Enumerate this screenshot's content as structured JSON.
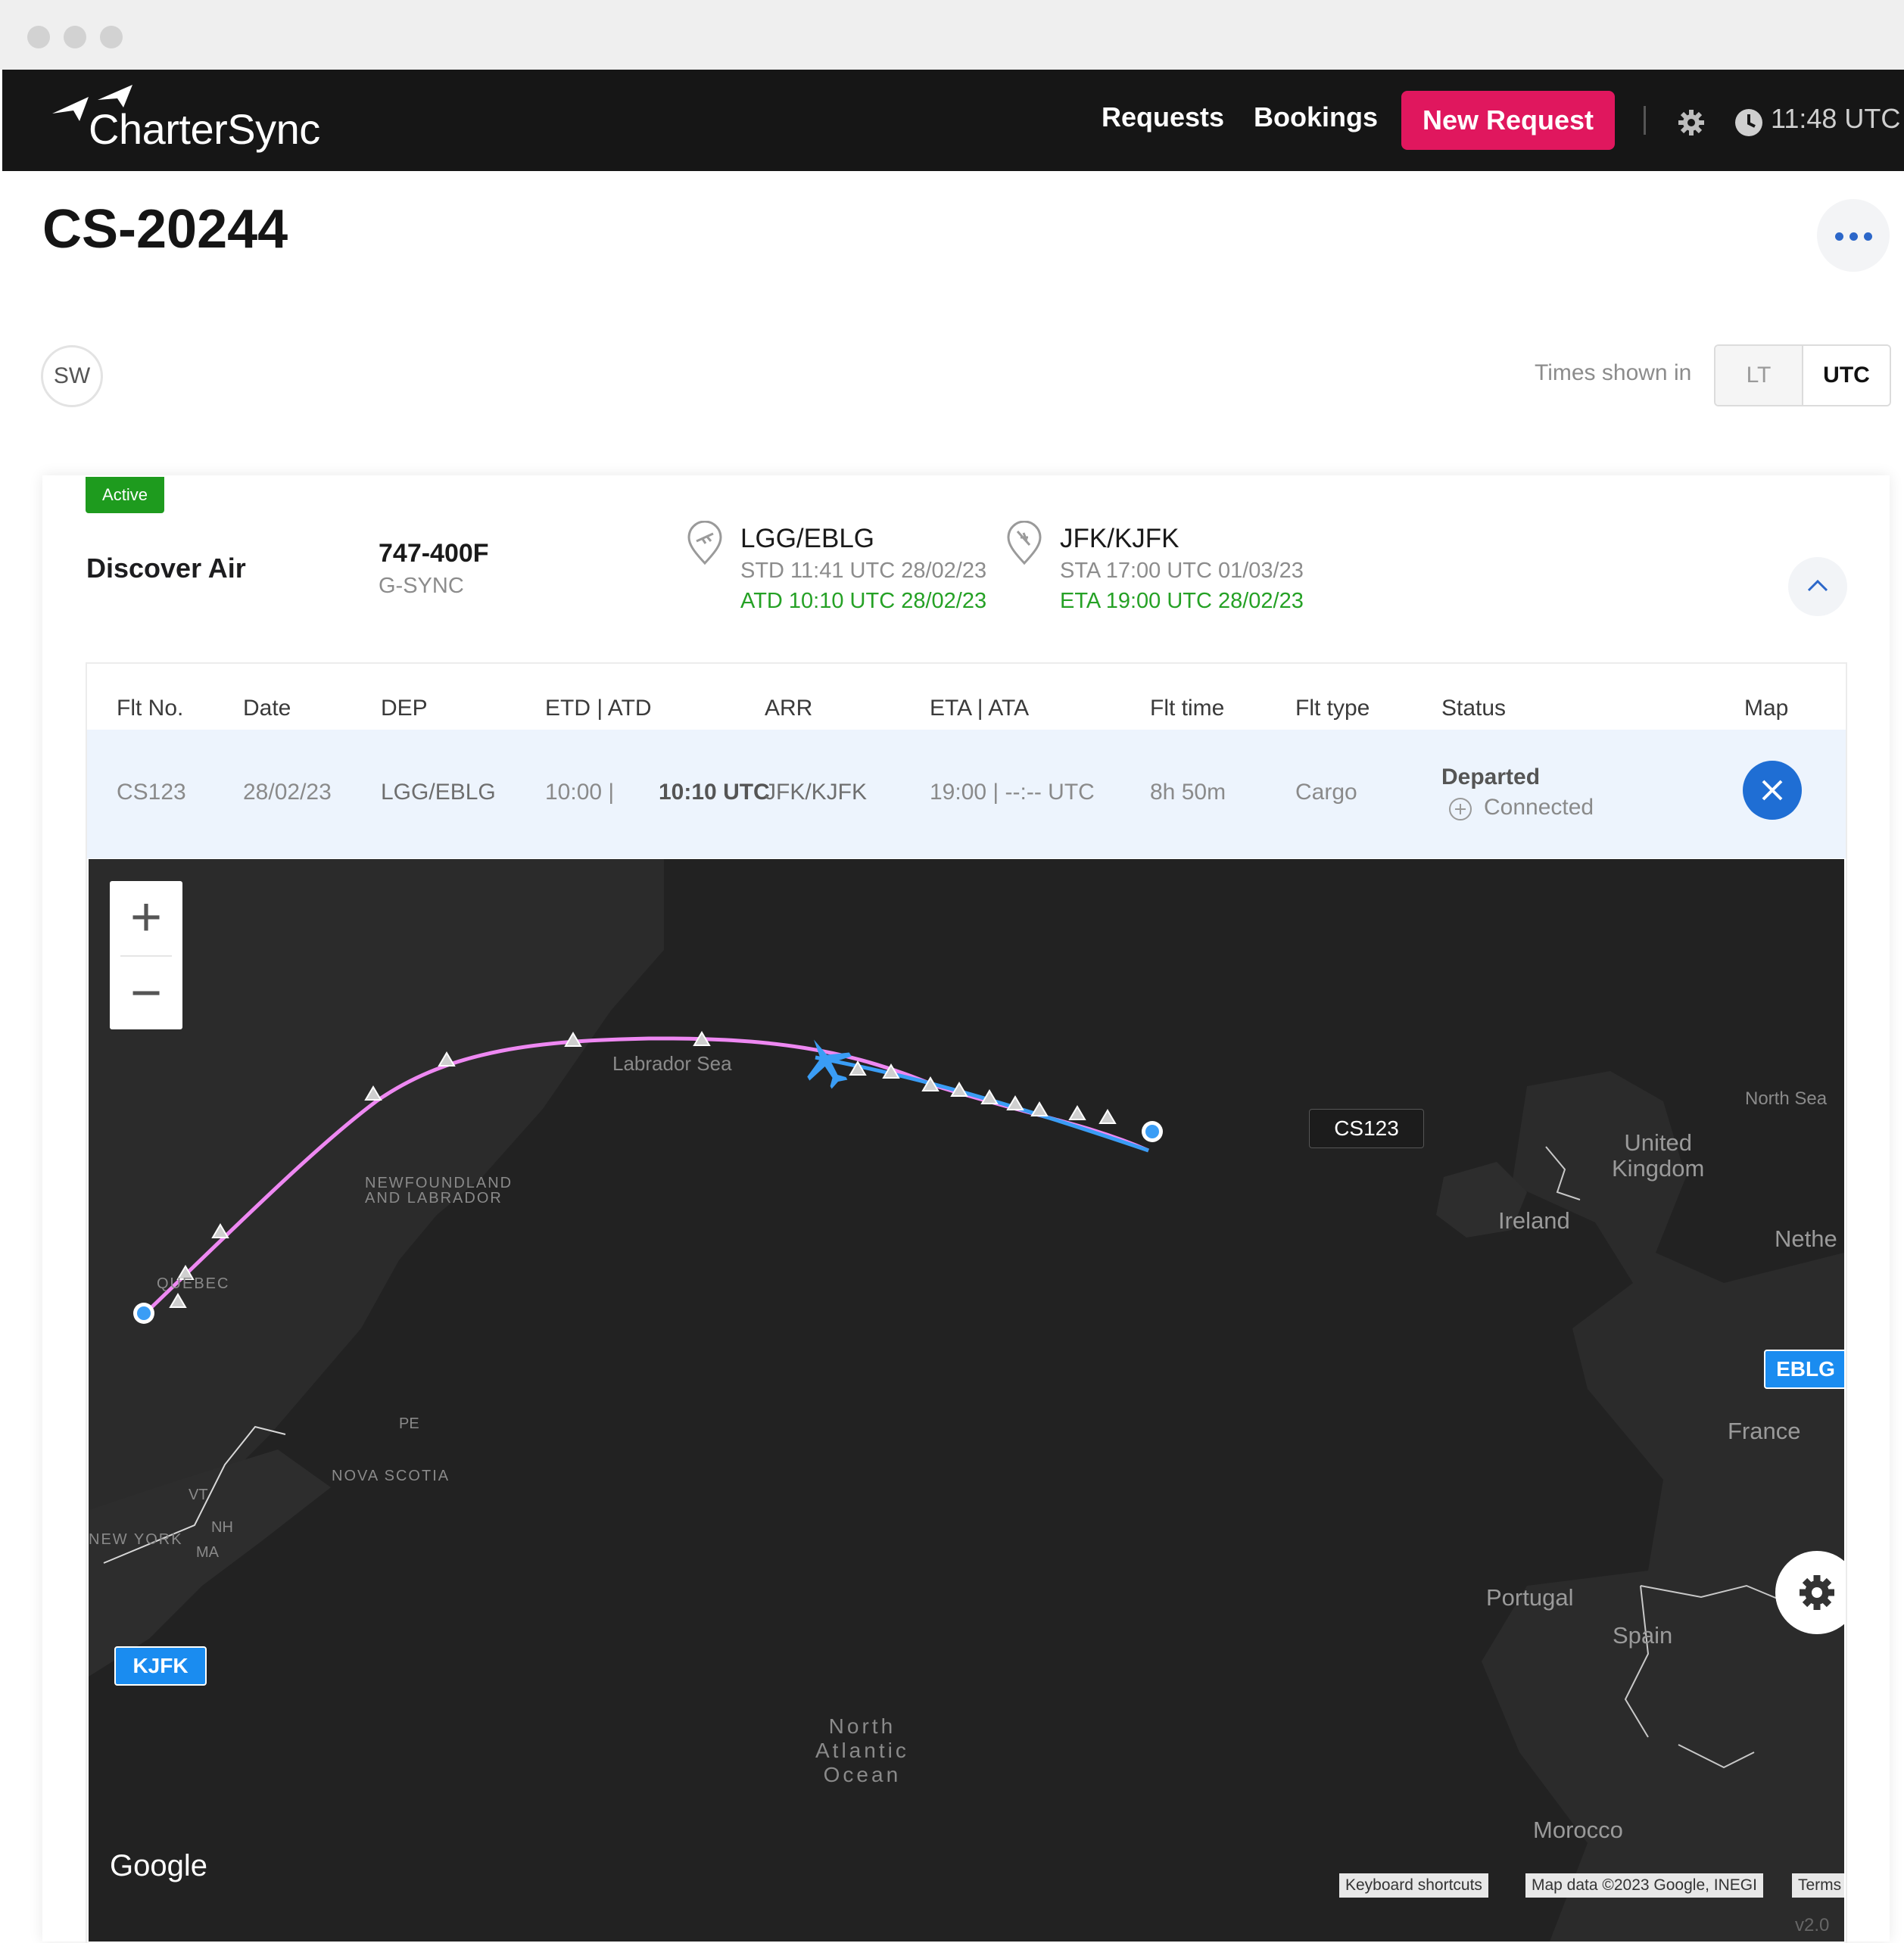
{
  "app": {
    "brand": "CharterSync",
    "nav": {
      "requests": "Requests",
      "bookings": "Bookings",
      "new_request": "New Request",
      "time": "11:48 UTC"
    }
  },
  "page": {
    "title": "CS-20244",
    "avatar_initials": "SW",
    "times_shown_in": "Times shown in",
    "timezone_options": [
      "LT",
      "UTC"
    ],
    "timezone_selected": "UTC"
  },
  "booking": {
    "status": "Active",
    "operator": "Discover Air",
    "aircraft_type": "747-400F",
    "registration": "G-SYNC",
    "departure": {
      "code": "LGG/EBLG",
      "scheduled": "STD 11:41 UTC 28/02/23",
      "actual": "ATD 10:10 UTC 28/02/23"
    },
    "arrival": {
      "code": "JFK/KJFK",
      "scheduled": "STA 17:00 UTC 01/03/23",
      "estimated": "ETA 19:00 UTC 28/02/23"
    }
  },
  "table": {
    "columns": [
      "Flt No.",
      "Date",
      "DEP",
      "ETD | ATD",
      "ARR",
      "ETA | ATA",
      "Flt time",
      "Flt type",
      "Status",
      "Map"
    ],
    "row": {
      "flight_no": "CS123",
      "date": "28/02/23",
      "dep": "LGG/EBLG",
      "etd": "10:00 |",
      "atd": "10:10 UTC",
      "arr": "JFK/KJFK",
      "eta_ata": "19:00 | --:-- UTC",
      "flight_time": "8h 50m",
      "flight_type": "Cargo",
      "status": "Departed",
      "connection": "Connected"
    }
  },
  "map": {
    "flight_label": "CS123",
    "origin_tag": "EBLG",
    "destination_tag": "KJFK",
    "route_color": "#e879f0",
    "track_color": "#3a9df5",
    "labels": {
      "labrador_sea": "Labrador Sea",
      "newfoundland": "NEWFOUNDLAND\nAND LABRADOR",
      "quebec": "QUEBEC",
      "nova_scotia": "NOVA SCOTIA",
      "pe": "PE",
      "new_york": "NEW YORK",
      "vt": "VT",
      "nh": "NH",
      "ma": "MA",
      "north_sea": "North Sea",
      "uk": "United\nKingdom",
      "ireland": "Ireland",
      "netherlands": "Nethe",
      "france": "France",
      "portugal": "Portugal",
      "spain": "Spain",
      "morocco": "Morocco",
      "ocean": "North\nAtlantic\nOcean"
    },
    "google": "Google",
    "attribution": [
      "Keyboard shortcuts",
      "Map data ©2023 Google, INEGI",
      "Terms"
    ],
    "version": "v2.0"
  }
}
